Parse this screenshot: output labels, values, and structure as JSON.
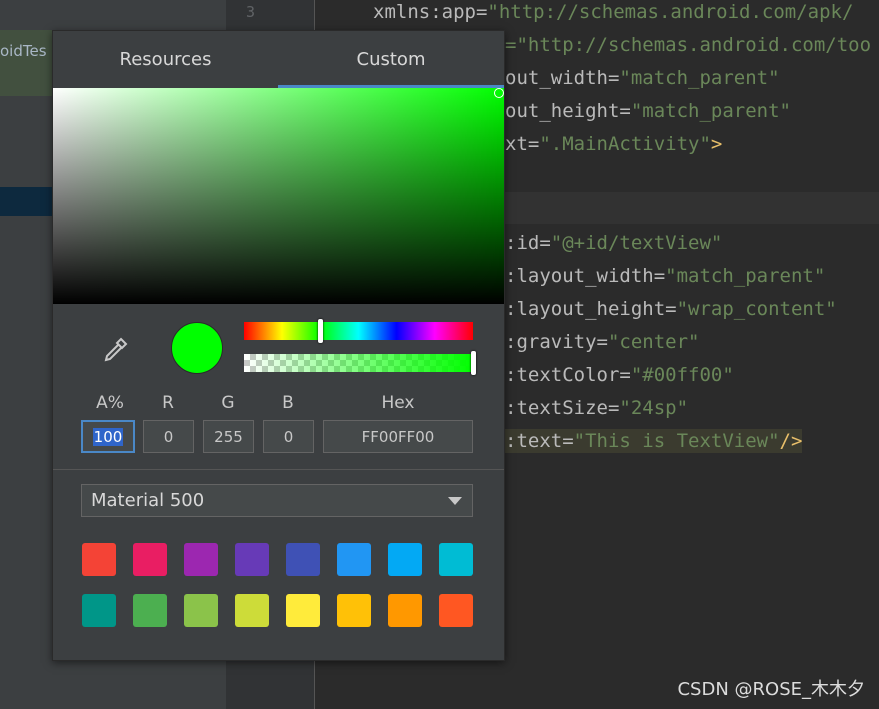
{
  "editor": {
    "gutter_line": "3",
    "lines": [
      {
        "attr": "xmlns:app=",
        "val": "\"http://schemas.android.com/apk/",
        "end": ""
      },
      {
        "attr": "",
        "val": "=\"http://schemas.android.com/too",
        "end": ""
      },
      {
        "attr": "out_width=",
        "val": "\"match_parent\"",
        "end": ""
      },
      {
        "attr": "out_height=",
        "val": "\"match_parent\"",
        "end": ""
      },
      {
        "attr": "xt=",
        "val": "\".MainActivity\"",
        "end": ">"
      },
      {
        "attr": ":id=",
        "val": "\"@+id/textView\"",
        "end": ""
      },
      {
        "attr": ":layout_width=",
        "val": "\"match_parent\"",
        "end": ""
      },
      {
        "attr": ":layout_height=",
        "val": "\"wrap_content\"",
        "end": ""
      },
      {
        "attr": ":gravity=",
        "val": "\"center\"",
        "end": ""
      },
      {
        "attr": ":textColor=",
        "val": "\"#00ff00\"",
        "end": ""
      },
      {
        "attr": ":textSize=",
        "val": "\"24sp\"",
        "end": ""
      },
      {
        "attr": ":text=",
        "val": "\"This is TextView\"",
        "end": "/>"
      }
    ],
    "left_label": "oidTes"
  },
  "picker": {
    "tabs": {
      "resources": "Resources",
      "custom": "Custom"
    },
    "active_tab": "Custom",
    "current_color": "#00ff00",
    "hue_fraction": 0.333,
    "alpha_fraction": 1.0,
    "labels": {
      "alpha": "A%",
      "r": "R",
      "g": "G",
      "b": "B",
      "hex": "Hex"
    },
    "values": {
      "alpha": "100",
      "r": "0",
      "g": "255",
      "b": "0",
      "hex": "FF00FF00"
    },
    "palette_selected": "Material 500",
    "swatches": [
      "#f44336",
      "#e91e63",
      "#9c27b0",
      "#673ab7",
      "#3f51b5",
      "#2196f3",
      "#03a9f4",
      "#00bcd4",
      "#009688",
      "#4caf50",
      "#8bc34a",
      "#cddc39",
      "#ffeb3b",
      "#ffc107",
      "#ff9800",
      "#ff5722"
    ]
  },
  "watermark": "CSDN @ROSE_木木夕"
}
